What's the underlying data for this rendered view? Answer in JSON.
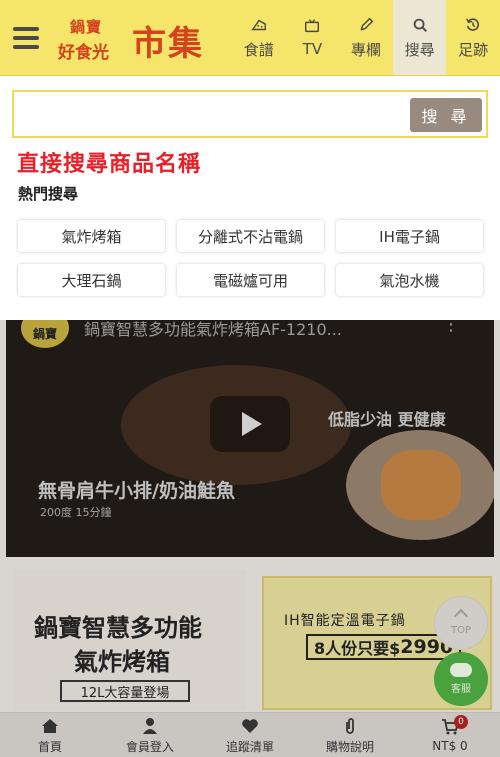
{
  "header": {
    "logo": {
      "line1": "鍋寶",
      "line2": "好食光",
      "main": "市集"
    },
    "nav": [
      {
        "label": "食譜",
        "icon": "recipe-icon"
      },
      {
        "label": "TV",
        "icon": "tv-icon"
      },
      {
        "label": "專欄",
        "icon": "pencil-icon"
      },
      {
        "label": "搜尋",
        "icon": "search-icon",
        "active": true
      },
      {
        "label": "足跡",
        "icon": "history-icon"
      }
    ]
  },
  "search": {
    "input_value": "",
    "button_label": "搜 尋",
    "hint": "直接搜尋商品名稱",
    "hot_title": "熱門搜尋",
    "hot_keywords": [
      "氣炸烤箱",
      "分離式不沾電鍋",
      "IH電子鍋",
      "大理石鍋",
      "電磁爐可用",
      "氣泡水機"
    ]
  },
  "video": {
    "badge": "鍋寶",
    "title": "鍋寶智慧多功能氣炸烤箱AF-1210...",
    "slogan": "低脂少油 更健康",
    "dish": "無骨肩牛小排/奶油鮭魚",
    "spec": "200度  15分鐘"
  },
  "banner_left": {
    "line1": "鍋寶智慧多功能",
    "line2": "氣炸烤箱",
    "sub": "12L大容量登場"
  },
  "banner_right": {
    "title": "IH智能定溫電子鍋",
    "price_prefix": "8人份只要$",
    "price": "2990"
  },
  "fab": {
    "top_label": "TOP",
    "chat_label": "客服"
  },
  "tabbar": [
    {
      "label": "首頁",
      "icon": "home-icon"
    },
    {
      "label": "會員登入",
      "icon": "user-icon"
    },
    {
      "label": "追蹤清單",
      "icon": "heart-icon"
    },
    {
      "label": "購物說明",
      "icon": "clip-icon"
    },
    {
      "label": "NT$ 0",
      "icon": "cart-icon",
      "badge": "0"
    }
  ],
  "colors": {
    "header_bg": "#f6e56b",
    "hint_red": "#e8202a",
    "logo_red": "#d4421e",
    "search_btn": "#998a80"
  }
}
